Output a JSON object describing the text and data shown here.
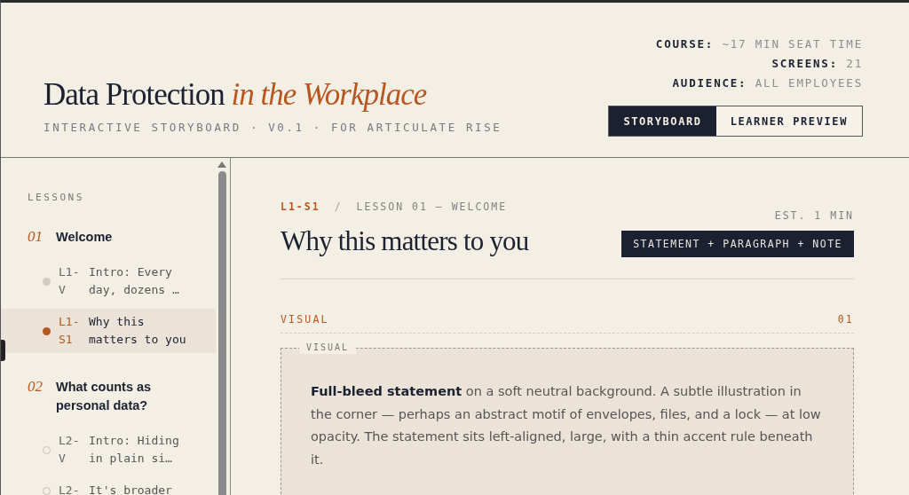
{
  "header": {
    "title": "Data Protection",
    "title_accent": "in the Workplace",
    "subtitle": "INTERACTIVE STORYBOARD · V0.1 · FOR ARTICULATE RISE",
    "meta": [
      {
        "label": "COURSE:",
        "value": "~17 MIN SEAT TIME"
      },
      {
        "label": "SCREENS:",
        "value": "21"
      },
      {
        "label": "AUDIENCE:",
        "value": "ALL EMPLOYEES"
      }
    ],
    "view_tabs": [
      {
        "label": "STORYBOARD",
        "selected": true
      },
      {
        "label": "LEARNER PREVIEW",
        "selected": false
      }
    ]
  },
  "sidebar": {
    "heading": "LESSONS",
    "lessons": [
      {
        "number": "01",
        "title": "Welcome",
        "screens": [
          {
            "code": "L1-V",
            "title": "Intro: Every day, dozens …",
            "visited": true,
            "selected": false
          },
          {
            "code": "L1-S1",
            "title": "Why this matters to you",
            "selected": true
          }
        ]
      },
      {
        "number": "02",
        "title": "What counts as personal data?",
        "screens": [
          {
            "code": "L2-V",
            "title": "Intro: Hiding in plain si…",
            "visited": false,
            "selected": false
          },
          {
            "code": "L2-",
            "title": "It's broader",
            "visited": false,
            "selected": false
          }
        ]
      }
    ]
  },
  "screen": {
    "code": "L1-S1",
    "separator": "/",
    "breadcrumb": "LESSON 01 — WELCOME",
    "title": "Why this matters to you",
    "estimate": "EST. 1 MIN",
    "pattern": "STATEMENT + PARAGRAPH + NOTE",
    "section": {
      "label": "VISUAL",
      "number": "01",
      "box_label": "VISUAL",
      "text": "**Full-bleed statement** on a soft neutral background. A subtle illustration in the corner — perhaps an abstract motif of envelopes, files, and a lock — at low opacity. The statement sits left-aligned, large, with a thin accent rule beneath it."
    }
  }
}
